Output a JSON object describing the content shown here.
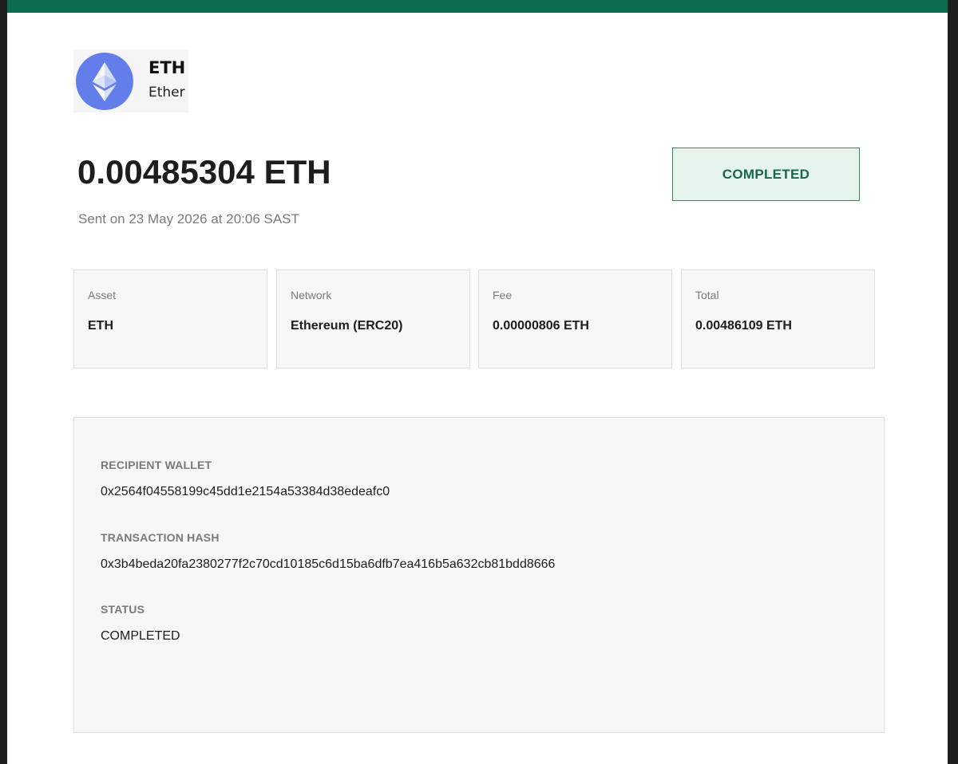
{
  "asset": {
    "symbol": "ETH",
    "name": "Ether",
    "logo_icon": "ethereum-diamond-icon",
    "logo_color": "#627eea"
  },
  "transaction": {
    "amount": "0.00485304 ETH",
    "sent_on": "Sent on 23 May 2026 at 20:06 SAST",
    "status_badge": "COMPLETED"
  },
  "summary_cards": [
    {
      "label": "Asset",
      "value": "ETH"
    },
    {
      "label": "Network",
      "value": "Ethereum (ERC20)"
    },
    {
      "label": "Fee",
      "value": "0.00000806 ETH"
    },
    {
      "label": "Total",
      "value": "0.00486109 ETH"
    }
  ],
  "details": {
    "recipient_label": "RECIPIENT WALLET",
    "recipient_value": "0x2564f04558199c45dd1e2154a53384d38edeafc0",
    "hash_label": "TRANSACTION HASH",
    "hash_value": "0x3b4beda20fa2380277f2c70cd10185c6d15ba6dfb7ea416b5a632cb81bdd8666",
    "status_label": "STATUS",
    "status_value": "COMPLETED"
  },
  "colors": {
    "top_bar": "#0d6b4f",
    "status_text": "#17684a",
    "status_background": "#e6f5ea",
    "status_border": "#2f8a5f"
  }
}
